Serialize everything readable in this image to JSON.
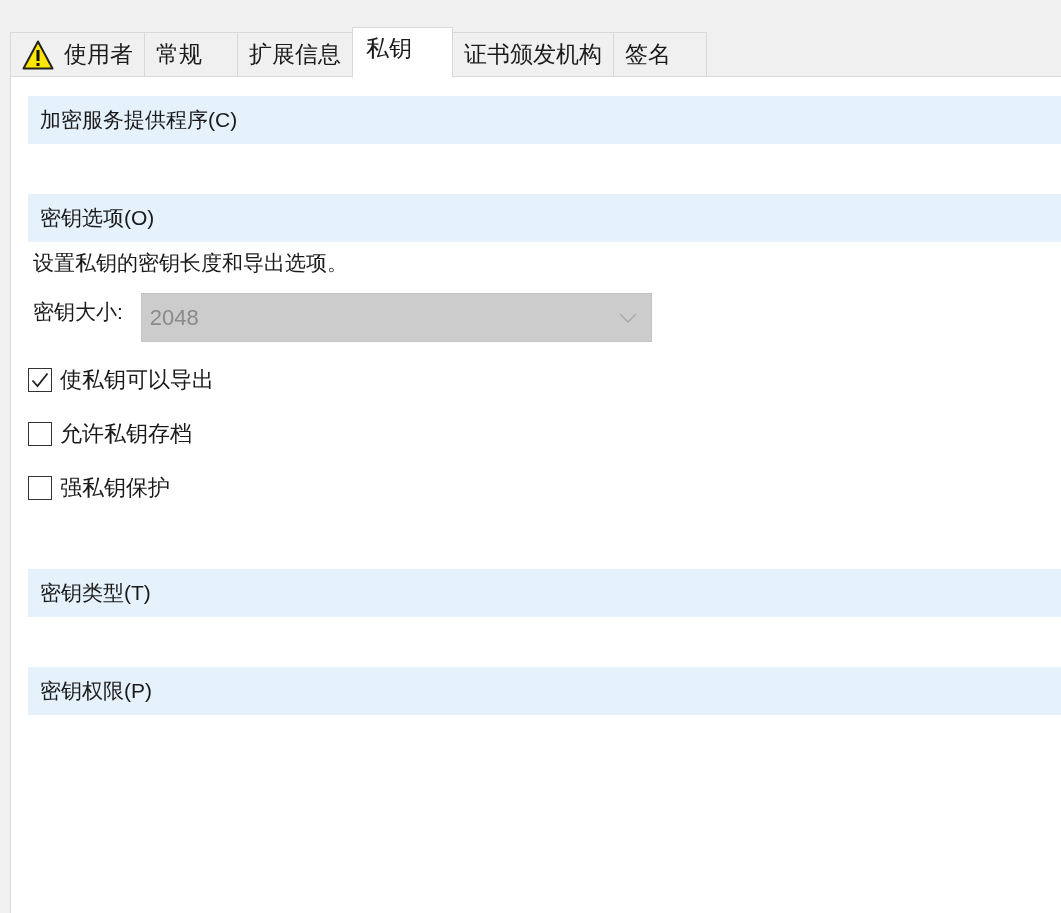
{
  "tabs": [
    {
      "label": "使用者",
      "kind": "warning",
      "selected": false
    },
    {
      "label": "常规",
      "kind": "text",
      "selected": false
    },
    {
      "label": "扩展信息",
      "kind": "text",
      "selected": false
    },
    {
      "label": "私钥",
      "kind": "text",
      "selected": true
    },
    {
      "label": "证书颁发机构",
      "kind": "text",
      "selected": false
    },
    {
      "label": "签名",
      "kind": "text",
      "selected": false
    }
  ],
  "sections": [
    {
      "title": "加密服务提供程序(C)"
    },
    {
      "title": "密钥选项(O)",
      "description": "设置私钥的密钥长度和导出选项。",
      "key_size": {
        "label": "密钥大小:",
        "value": "2048",
        "disabled": true
      },
      "options": [
        {
          "label": "使私钥可以导出",
          "checked": true
        },
        {
          "label": "允许私钥存档",
          "checked": false
        },
        {
          "label": "强私钥保护",
          "checked": false
        }
      ]
    },
    {
      "title": "密钥类型(T)"
    },
    {
      "title": "密钥权限(P)"
    }
  ]
}
